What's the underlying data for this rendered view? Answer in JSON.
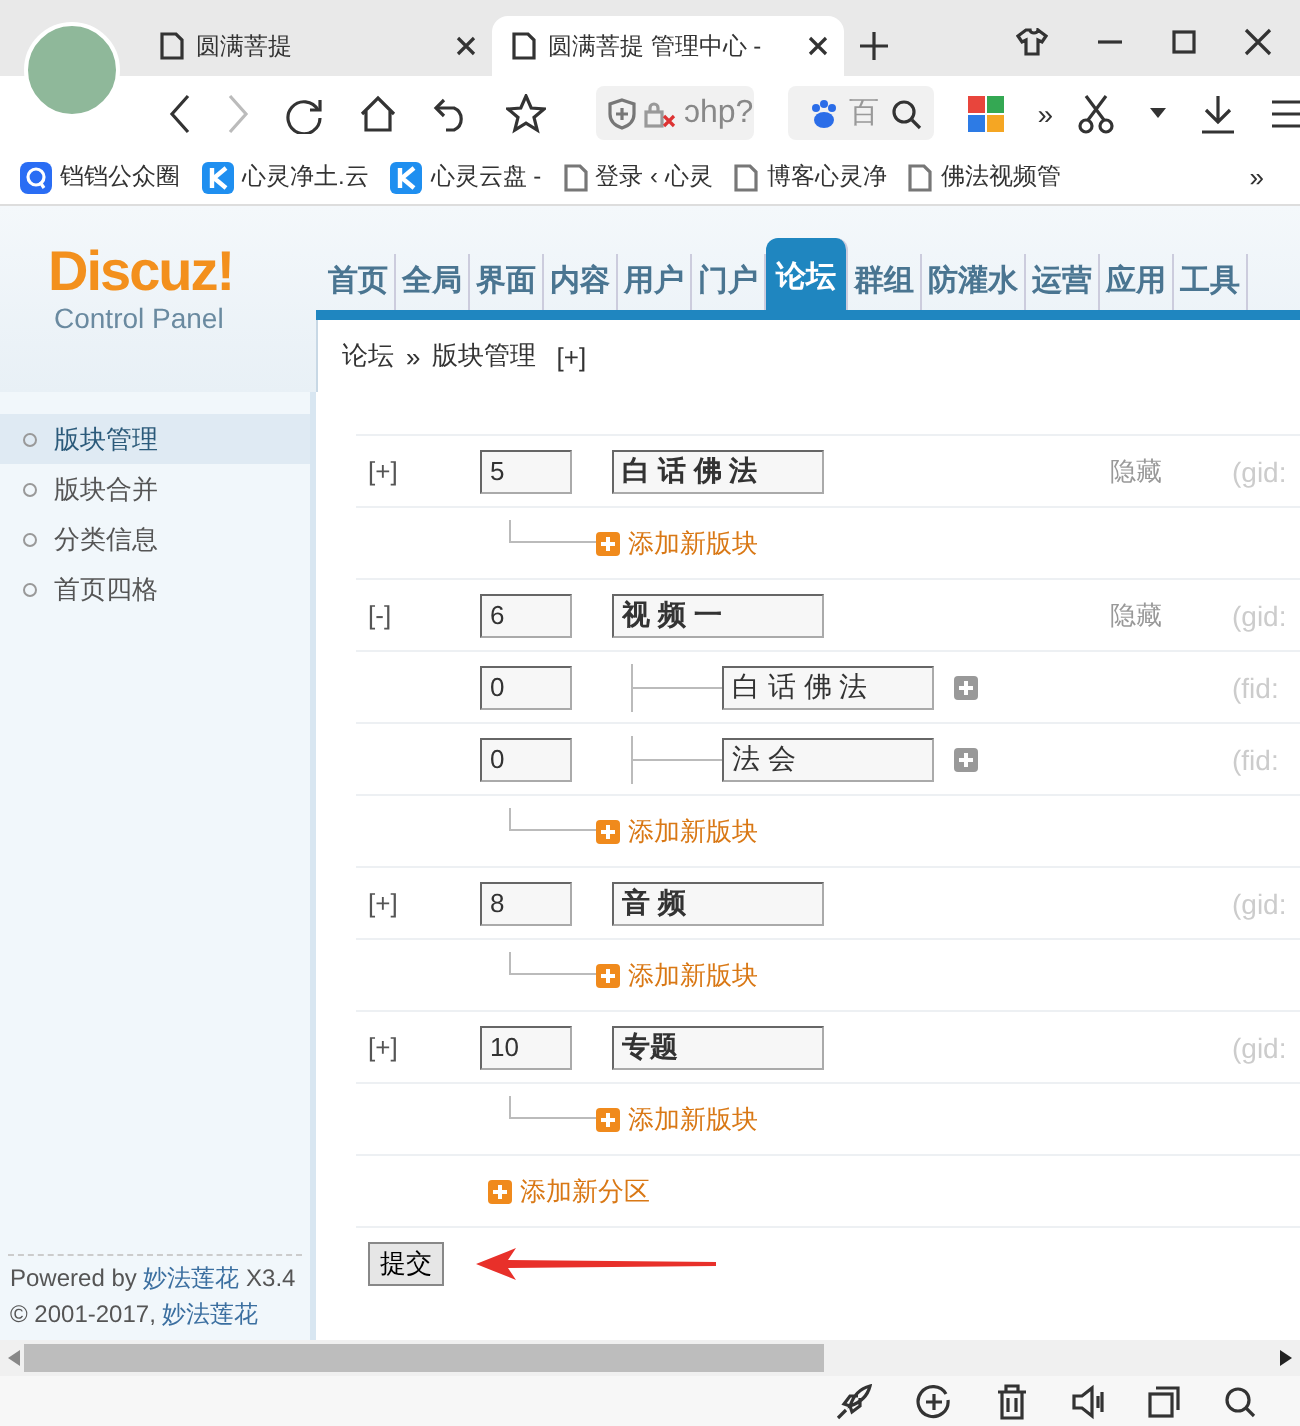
{
  "browser": {
    "tabs": [
      {
        "title": "圆满菩提",
        "selected": false
      },
      {
        "title": "圆满菩提 管理中心 -",
        "selected": true
      }
    ],
    "address": "ɔhp?",
    "search_text": "百",
    "more": "»",
    "bookmarks": [
      {
        "label": "铛铛公众圈",
        "kind": "q"
      },
      {
        "label": "心灵净土.云",
        "kind": "k"
      },
      {
        "label": "心灵云盘 -",
        "kind": "k"
      },
      {
        "label": "登录 ‹ 心灵",
        "kind": "page"
      },
      {
        "label": "博客心灵净",
        "kind": "page"
      },
      {
        "label": "佛法视频管",
        "kind": "page"
      }
    ],
    "bookmarks_more": "»"
  },
  "header": {
    "logo_title": "Discuz!",
    "logo_subtitle": "Control Panel",
    "nav": [
      {
        "label": "首页",
        "selected": false
      },
      {
        "label": "全局",
        "selected": false
      },
      {
        "label": "界面",
        "selected": false
      },
      {
        "label": "内容",
        "selected": false
      },
      {
        "label": "用户",
        "selected": false
      },
      {
        "label": "门户",
        "selected": false
      },
      {
        "label": "论坛",
        "selected": true
      },
      {
        "label": "群组",
        "selected": false
      },
      {
        "label": "防灌水",
        "selected": false
      },
      {
        "label": "运营",
        "selected": false
      },
      {
        "label": "应用",
        "selected": false
      },
      {
        "label": "工具",
        "selected": false
      }
    ]
  },
  "breadcrumb": {
    "items": [
      "论坛",
      "版块管理"
    ],
    "separator": "»",
    "action": "[+]"
  },
  "sidebar": {
    "items": [
      {
        "label": "版块管理",
        "selected": true
      },
      {
        "label": "版块合并",
        "selected": false
      },
      {
        "label": "分类信息",
        "selected": false
      },
      {
        "label": "首页四格",
        "selected": false
      }
    ]
  },
  "footer": {
    "powered_prefix": "Powered by",
    "powered_link": "妙法莲花",
    "version": "X3.4",
    "copyright": "© 2001-2017,",
    "copyright_link": "妙法莲花"
  },
  "categories": [
    {
      "toggle": "[+]",
      "order": "5",
      "name": "白 话 佛 法",
      "status": "隐藏",
      "id": "(gid:",
      "add_label": "添加新版块"
    },
    {
      "toggle": "[-]",
      "order": "6",
      "name": "视 频 一",
      "status": "隐藏",
      "id": "(gid:",
      "forums": [
        {
          "order": "0",
          "name": "白 话 佛 法",
          "id": "(fid:"
        },
        {
          "order": "0",
          "name": "法 会",
          "id": "(fid:"
        }
      ],
      "add_label": "添加新版块"
    },
    {
      "toggle": "[+]",
      "order": "8",
      "name": "音 频",
      "id": "(gid:",
      "add_label": "添加新版块"
    },
    {
      "toggle": "[+]",
      "order": "10",
      "name": "专题",
      "id": "(gid:",
      "add_label": "添加新版块"
    }
  ],
  "add_category": "添加新分区",
  "submit": "提交"
}
